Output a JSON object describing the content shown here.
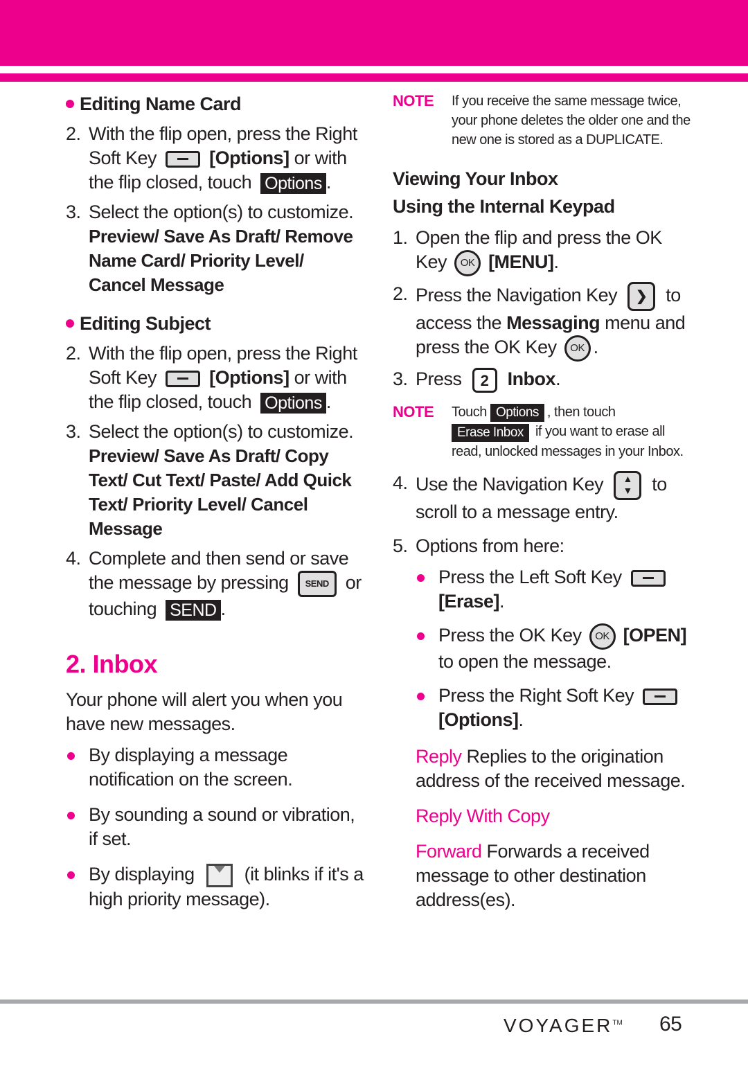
{
  "colors": {
    "accent": "#ec008c",
    "text": "#231f20",
    "footer_rule": "#a7a9ac"
  },
  "left": {
    "editing_name_card": {
      "heading": "Editing Name Card",
      "step2": {
        "num": "2.",
        "pre": "With the flip open, press the Right Soft Key",
        "bold": "[Options]",
        "mid": " or with the flip closed, touch",
        "button": "Options",
        "post": "."
      },
      "step3": {
        "num": "3.",
        "text": "Select the option(s) to customize.",
        "options": "Preview/ Save As Draft/ Remove Name Card/ Priority Level/ Cancel Message"
      }
    },
    "editing_subject": {
      "heading": "Editing Subject",
      "step2": {
        "num": "2.",
        "pre": "With the flip open, press the Right Soft Key",
        "bold": "[Options]",
        "mid": " or with the flip closed, touch",
        "button": "Options",
        "post": "."
      },
      "step3": {
        "num": "3.",
        "text": "Select the option(s) to customize.",
        "options": "Preview/ Save As Draft/ Copy Text/ Cut Text/ Paste/ Add Quick Text/ Priority Level/ Cancel Message"
      },
      "step4": {
        "num": "4.",
        "pre": "Complete and then send or save the message by pressing",
        "key": "SEND",
        "mid": "or touching",
        "button": "SEND",
        "post": "."
      }
    },
    "inbox": {
      "title": "2. Inbox",
      "intro": "Your phone will alert you when you have new messages.",
      "bullets": [
        "By displaying a message notification on the screen.",
        "By sounding a sound or vibration, if set."
      ],
      "bullet3_pre": "By displaying",
      "bullet3_post": "(it blinks if it's a high priority message)."
    }
  },
  "right": {
    "note1": {
      "label": "NOTE",
      "text": "If you receive the same message twice, your phone deletes the older one and the new one is stored as a DUPLICATE."
    },
    "heading": [
      "Viewing Your Inbox",
      "Using the Internal Keypad"
    ],
    "step1": {
      "num": "1.",
      "pre": "Open the flip and press the OK Key",
      "key": "OK",
      "bold": "[MENU]",
      "post": "."
    },
    "step2": {
      "num": "2.",
      "pre": "Press the Navigation Key",
      "post1": "to access the",
      "bold": "Messaging",
      "post2": "menu and press the OK Key",
      "key": "OK",
      "end": "."
    },
    "step3": {
      "num": "3.",
      "pre": "Press",
      "key": "2",
      "bold": "Inbox",
      "post": "."
    },
    "note2": {
      "label": "NOTE",
      "pre": "Touch",
      "button1": "Options",
      "mid": ", then touch",
      "button2": "Erase Inbox",
      "post": "if you want to erase all read, unlocked messages in your Inbox."
    },
    "step4": {
      "num": "4.",
      "pre": "Use the Navigation Key",
      "post": "to scroll to a message entry."
    },
    "step5": {
      "num": "5.",
      "text": "Options from here:"
    },
    "sub_bullets": [
      {
        "pre": "Press the Left Soft Key",
        "bold": "[Erase]",
        "post": "."
      },
      {
        "pre": "Press the OK Key",
        "key": "OK",
        "bold": "[OPEN]",
        "post": " to open the message."
      },
      {
        "pre": "Press the Right Soft Key",
        "bold": "[Options]",
        "post": "."
      }
    ],
    "terms": [
      {
        "term": "Reply",
        "desc": "Replies to the origination address of the received message."
      },
      {
        "term": "Reply With Copy",
        "desc": ""
      },
      {
        "term": "Forward",
        "desc": "Forwards a received message to other destination address(es)."
      }
    ]
  },
  "footer": {
    "brand": "VOYAGER",
    "trademark": "TM",
    "page": "65"
  }
}
